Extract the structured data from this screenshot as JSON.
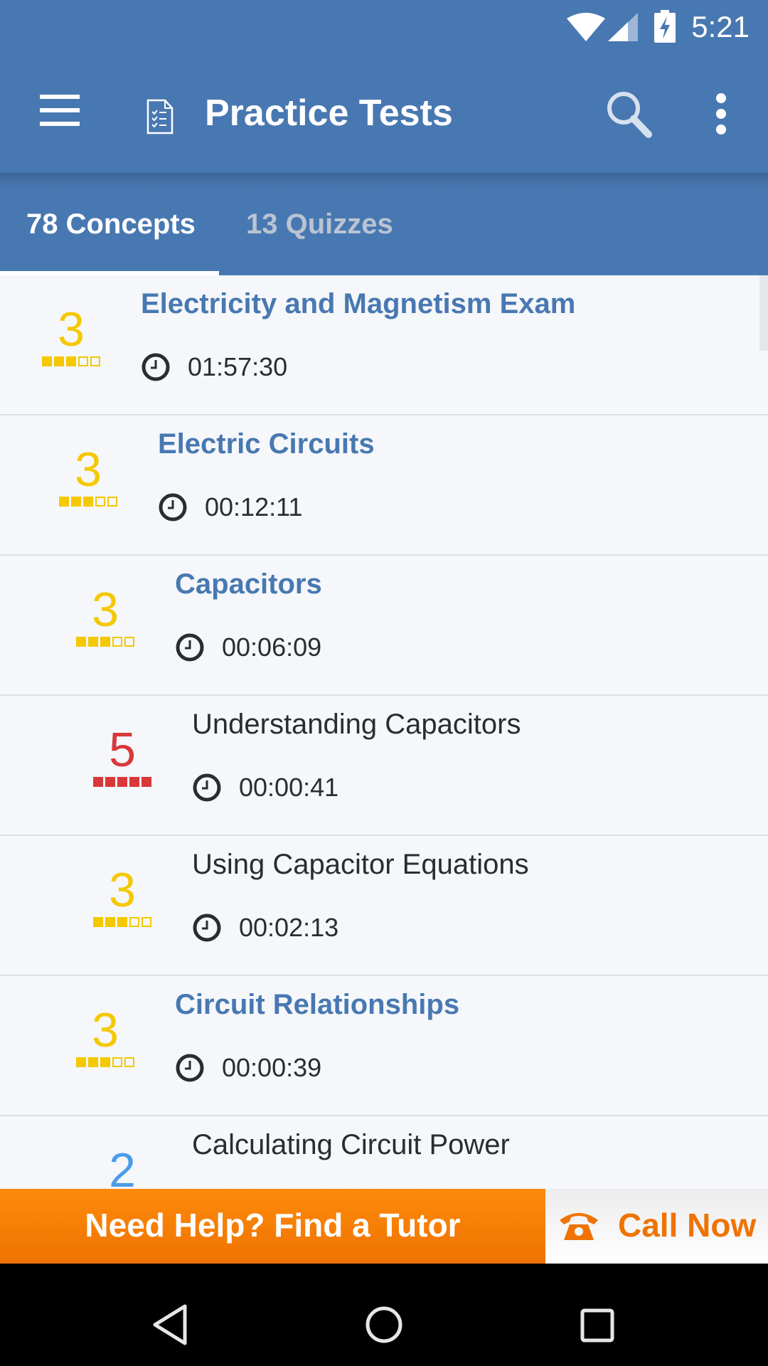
{
  "status_bar": {
    "time": "5:21",
    "icons": [
      "wifi-icon",
      "cell-signal-icon",
      "battery-charging-icon"
    ]
  },
  "toolbar": {
    "title": "Practice Tests",
    "icons": [
      "menu-icon",
      "checklist-document-icon",
      "search-icon",
      "more-vert-icon"
    ]
  },
  "tabs": [
    {
      "label": "78 Concepts",
      "selected": true
    },
    {
      "label": "13 Quizzes",
      "selected": false
    }
  ],
  "colors": {
    "primary": "#4878b1",
    "score_yellow": "#f5c800",
    "score_red": "#d9383a",
    "score_blue": "#4a9be8",
    "cta_orange": "#f57c00"
  },
  "list": [
    {
      "title": "Electricity and Magnetism Exam",
      "time": "01:57:30",
      "score": "3",
      "score_of": 5,
      "level": 0,
      "style": "bold",
      "color": "yellow"
    },
    {
      "title": "Electric Circuits",
      "time": "00:12:11",
      "score": "3",
      "score_of": 5,
      "level": 1,
      "style": "bold",
      "color": "yellow"
    },
    {
      "title": "Capacitors",
      "time": "00:06:09",
      "score": "3",
      "score_of": 5,
      "level": 2,
      "style": "bold",
      "color": "yellow"
    },
    {
      "title": "Understanding Capacitors",
      "time": "00:00:41",
      "score": "5",
      "score_of": 5,
      "level": 3,
      "style": "plain",
      "color": "red"
    },
    {
      "title": "Using Capacitor Equations",
      "time": "00:02:13",
      "score": "3",
      "score_of": 5,
      "level": 3,
      "style": "plain",
      "color": "yellow"
    },
    {
      "title": "Circuit Relationships",
      "time": "00:00:39",
      "score": "3",
      "score_of": 5,
      "level": 2,
      "style": "bold",
      "color": "yellow"
    },
    {
      "title": "Calculating Circuit Power",
      "time": "",
      "score": "2",
      "score_of": 5,
      "level": 3,
      "style": "plain",
      "color": "blue"
    }
  ],
  "cta": {
    "tutor_label": "Need Help? Find a Tutor",
    "call_label": "Call Now"
  },
  "nav_bar": {
    "icons": [
      "back-icon",
      "home-icon",
      "recent-apps-icon"
    ]
  }
}
